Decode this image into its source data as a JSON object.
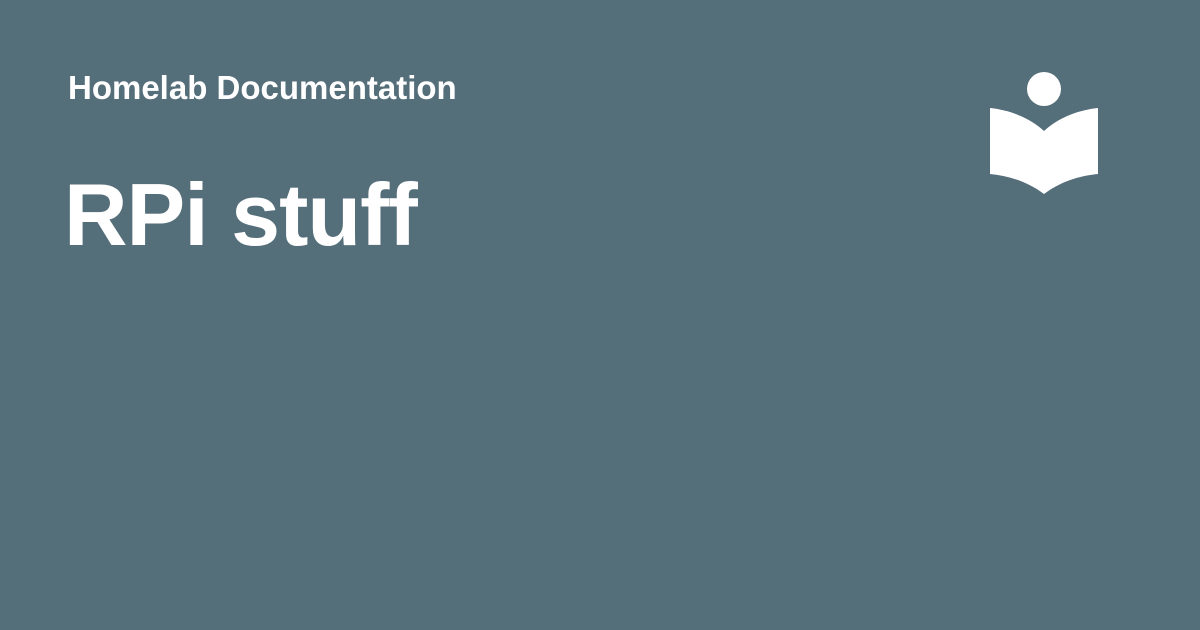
{
  "site": {
    "name": "Homelab Documentation"
  },
  "page": {
    "title": "RPi stuff"
  },
  "logo": {
    "icon": "book-reader-icon"
  },
  "colors": {
    "background": "#546e7a",
    "foreground": "#ffffff"
  }
}
